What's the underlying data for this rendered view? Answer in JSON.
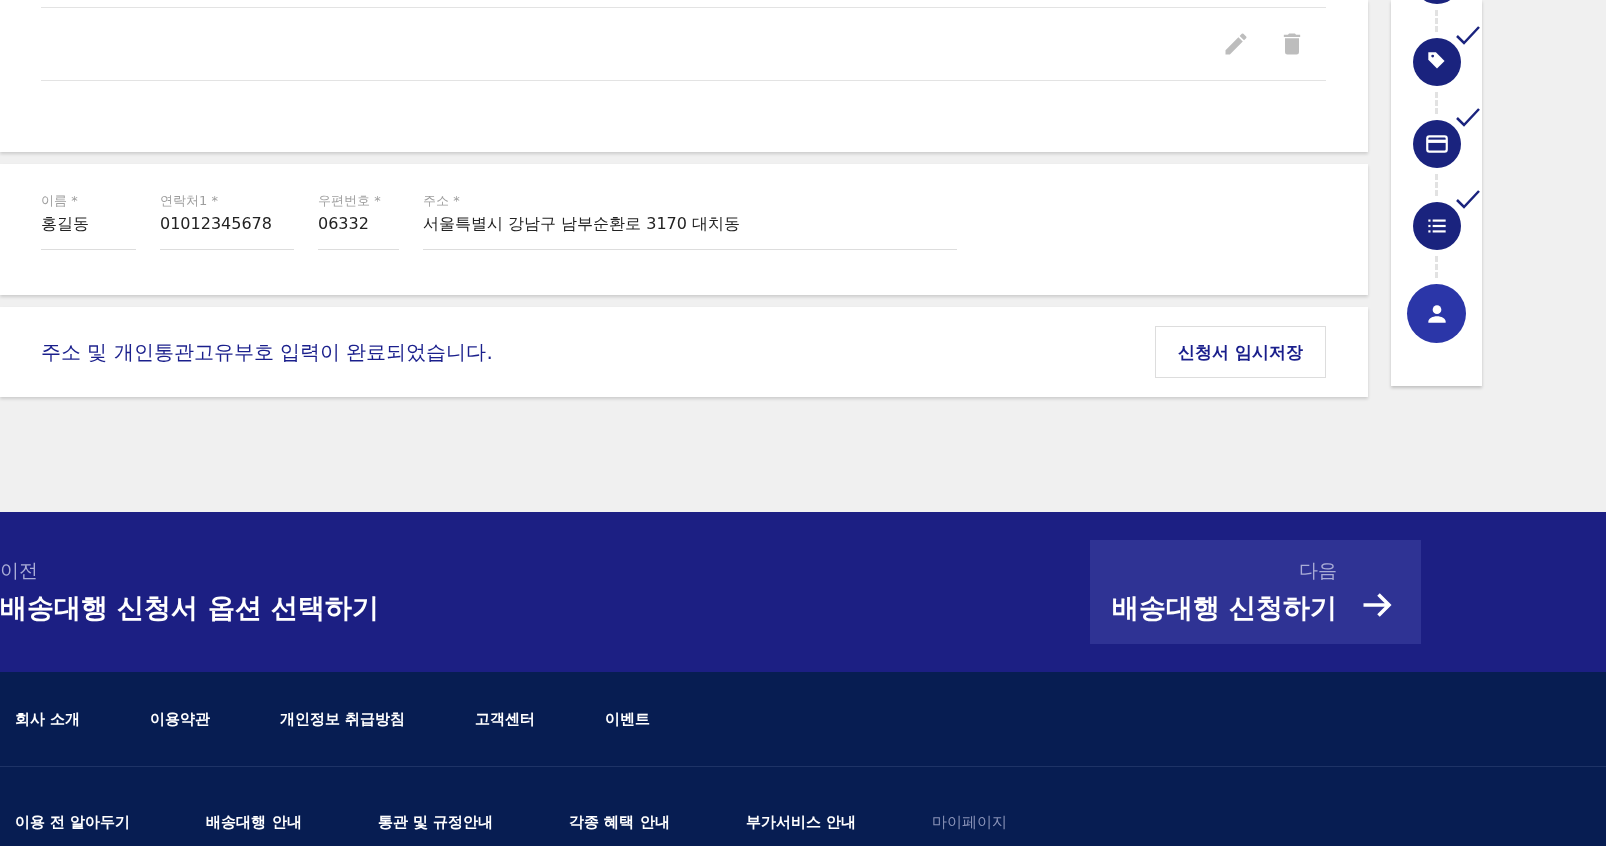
{
  "address_card": {
    "fields": [
      {
        "label": "이름 *",
        "value": "홍길동"
      },
      {
        "label": "연락처1 *",
        "value": "01012345678"
      },
      {
        "label": "우편번호 *",
        "value": "06332"
      },
      {
        "label": "주소 *",
        "value": "서울특별시 강남구 남부순환로 3170 대치동"
      }
    ]
  },
  "status_card": {
    "message": "주소 및 개인통관고유부호 입력이 완료되었습니다.",
    "save_button": "신청서 임시저장"
  },
  "stepper": [
    {
      "kind": "tag",
      "checked": true,
      "selected": false
    },
    {
      "kind": "card",
      "checked": true,
      "selected": false
    },
    {
      "kind": "list",
      "checked": true,
      "selected": false
    },
    {
      "kind": "person",
      "checked": false,
      "selected": true
    }
  ],
  "nav": {
    "prev": {
      "caption": "이전",
      "title": "배송대행 신청서 옵션 선택하기"
    },
    "next": {
      "caption": "다음",
      "title": "배송대행 신청하기"
    }
  },
  "footer": {
    "top_links": [
      {
        "label": "회사 소개"
      },
      {
        "label": "이용약관"
      },
      {
        "label": "개인정보 취급방침"
      },
      {
        "label": "고객센터"
      },
      {
        "label": "이벤트"
      }
    ],
    "bottom_links": [
      {
        "label": "이용 전 알아두기",
        "selected": false
      },
      {
        "label": "배송대행 안내",
        "selected": false
      },
      {
        "label": "통관 및 규정안내",
        "selected": false
      },
      {
        "label": "각종 혜택 안내",
        "selected": false
      },
      {
        "label": "부가서비스 안내",
        "selected": false
      },
      {
        "label": "마이페이지",
        "selected": true
      }
    ]
  }
}
